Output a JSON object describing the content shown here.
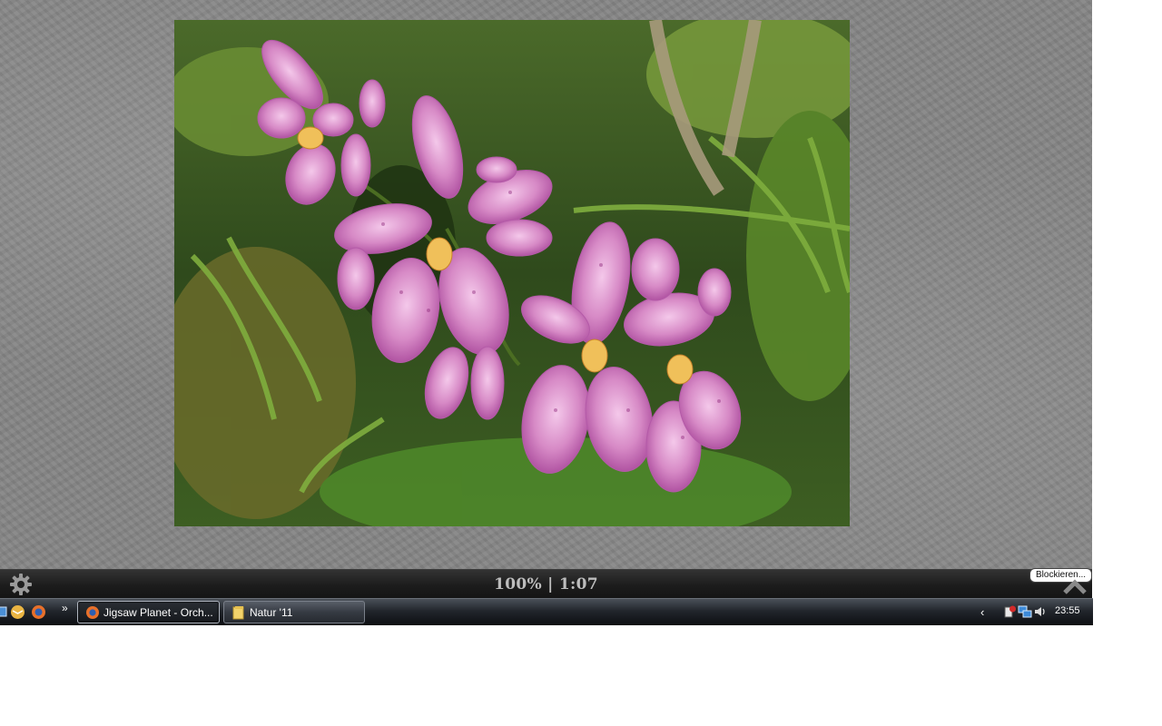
{
  "game": {
    "status": "100% | 1:07",
    "tooltip": "Blockieren..."
  },
  "taskbar": {
    "quick_launch": [
      "show-desktop-icon",
      "thunderbird-icon",
      "firefox-icon"
    ],
    "more_glyph": "»",
    "tasks": [
      {
        "label": "Jigsaw Planet - Orch...",
        "icon": "firefox-icon",
        "active": true
      },
      {
        "label": "Natur '11",
        "icon": "folder-icon",
        "active": false
      }
    ],
    "tray": {
      "expand_glyph": "‹",
      "icons": [
        "safely-remove-hardware-icon",
        "network-icon",
        "volume-icon"
      ],
      "clock": "23:55"
    }
  },
  "colors": {
    "background_gray": "#858585",
    "bar_dark": "#1c1c1c",
    "status_text": "#bdbdbd",
    "orchid_pink": "#d27ac0"
  }
}
